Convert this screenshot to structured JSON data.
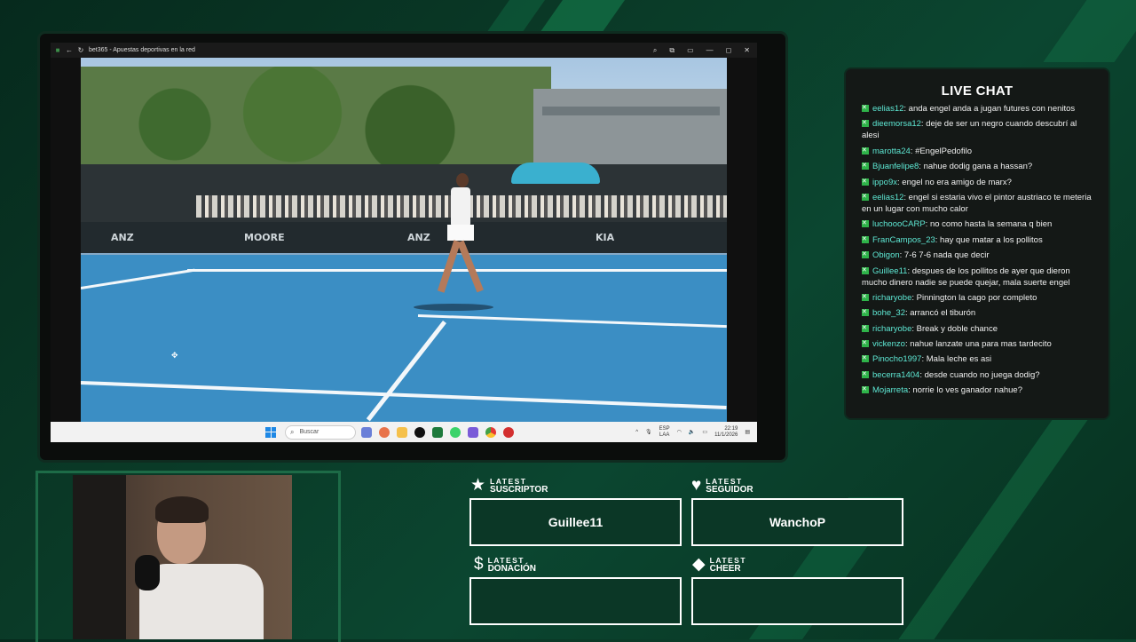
{
  "browser": {
    "title": "bet365 - Apuestas deportivas en la red"
  },
  "video": {
    "board_texts": [
      "ANZ",
      "MOORE",
      "ANZ",
      "KIA"
    ]
  },
  "taskbar": {
    "search_placeholder": "Buscar",
    "language_top": "ESP",
    "language_bottom": "LAA",
    "time": "22:19",
    "date": "11/1/2026"
  },
  "chat": {
    "title": "LIVE CHAT",
    "messages": [
      {
        "user": "eelias12",
        "text": "anda engel anda a jugan futures con nenitos"
      },
      {
        "user": "dieemorsa12",
        "text": "deje de ser un negro cuando descubrí al alesi"
      },
      {
        "user": "marotta24",
        "text": "#EngelPedofilo"
      },
      {
        "user": "Bjuanfelipe8",
        "text": "nahue dodig gana a hassan?"
      },
      {
        "user": "ippo9x",
        "text": "engel no era amigo de marx?"
      },
      {
        "user": "eelias12",
        "text": "engel si estaria vivo el pintor austriaco te meteria en un lugar con mucho calor"
      },
      {
        "user": "luchoooCARP",
        "text": "no como hasta la semana q bien"
      },
      {
        "user": "FranCampos_23",
        "text": "hay que matar a los pollitos"
      },
      {
        "user": "Obigon",
        "text": "7-6 7-6 nada que decir"
      },
      {
        "user": "Guillee11",
        "text": "despues de los pollitos de ayer que dieron mucho dinero nadie se puede quejar, mala suerte engel"
      },
      {
        "user": "richaryobe",
        "text": "Pinnington la cago por completo"
      },
      {
        "user": "bohe_32",
        "text": "arrancó el tiburón"
      },
      {
        "user": "richaryobe",
        "text": "Break y doble chance"
      },
      {
        "user": "vickenzo",
        "text": "nahue lanzate una para mas tardecito"
      },
      {
        "user": "Pinocho1997",
        "text": "Mala leche es asi"
      },
      {
        "user": "becerra1404",
        "text": "desde cuando no juega dodig?"
      },
      {
        "user": "Mojarreta",
        "text": "norrie lo ves ganador nahue?"
      }
    ]
  },
  "overlay": {
    "suscriptor": {
      "label_top": "LATEST",
      "label_bottom": "SUSCRIPTOR",
      "value": "Guillee11",
      "icon": "star-icon"
    },
    "seguidor": {
      "label_top": "LATEST",
      "label_bottom": "SEGUIDOR",
      "value": "WanchoP",
      "icon": "heart-icon"
    },
    "donacion": {
      "label_top": "LATEST",
      "label_bottom": "DONACIÓN",
      "value": "",
      "icon": "dollar-icon"
    },
    "cheer": {
      "label_top": "LATEST",
      "label_bottom": "CHEER",
      "value": "",
      "icon": "diamond-icon"
    }
  },
  "colors": {
    "background": "#0a3a27",
    "chat_username": "#5ee8d4",
    "chat_badge": "#2fb44a",
    "info_box_bg": "#0b3726"
  }
}
